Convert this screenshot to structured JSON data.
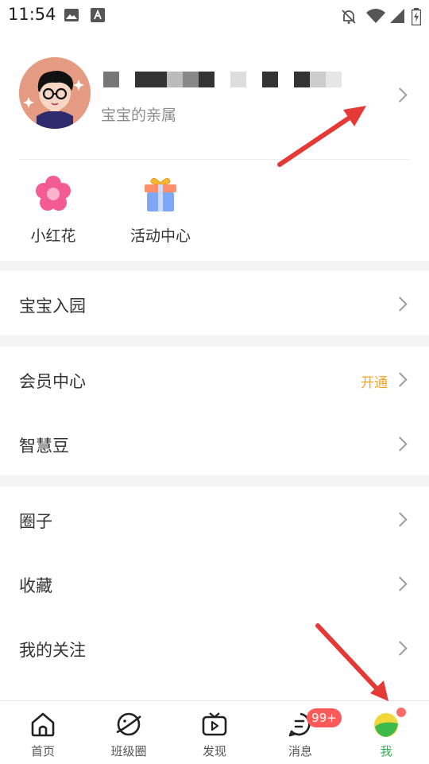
{
  "status_bar": {
    "time": "11:54",
    "icons": [
      "image-icon",
      "font-icon",
      "bell-off-icon",
      "wifi-icon",
      "signal-icon",
      "battery-icon"
    ]
  },
  "profile": {
    "subtitle": "宝宝的亲属",
    "avatar": "cartoon-boy-avatar"
  },
  "quick_actions": [
    {
      "label": "小红花",
      "icon": "flower-icon"
    },
    {
      "label": "活动中心",
      "icon": "gift-icon"
    }
  ],
  "sections": [
    [
      {
        "label": "宝宝入园"
      }
    ],
    [
      {
        "label": "会员中心",
        "hint": "开通"
      },
      {
        "label": "智慧豆"
      }
    ],
    [
      {
        "label": "圈子"
      },
      {
        "label": "收藏"
      },
      {
        "label": "我的关注"
      }
    ]
  ],
  "tabbar": {
    "tabs": [
      {
        "label": "首页",
        "icon": "home-icon"
      },
      {
        "label": "班级圈",
        "icon": "planet-icon"
      },
      {
        "label": "发现",
        "icon": "tv-play-icon"
      },
      {
        "label": "消息",
        "icon": "message-icon",
        "badge": "99+"
      },
      {
        "label": "我",
        "icon": "me-avatar-icon",
        "active": true
      }
    ]
  },
  "colors": {
    "accent_green": "#2fb14a",
    "badge_red": "#ff5a5a",
    "hint_orange": "#f5a623",
    "annotation_red": "#e53935"
  }
}
